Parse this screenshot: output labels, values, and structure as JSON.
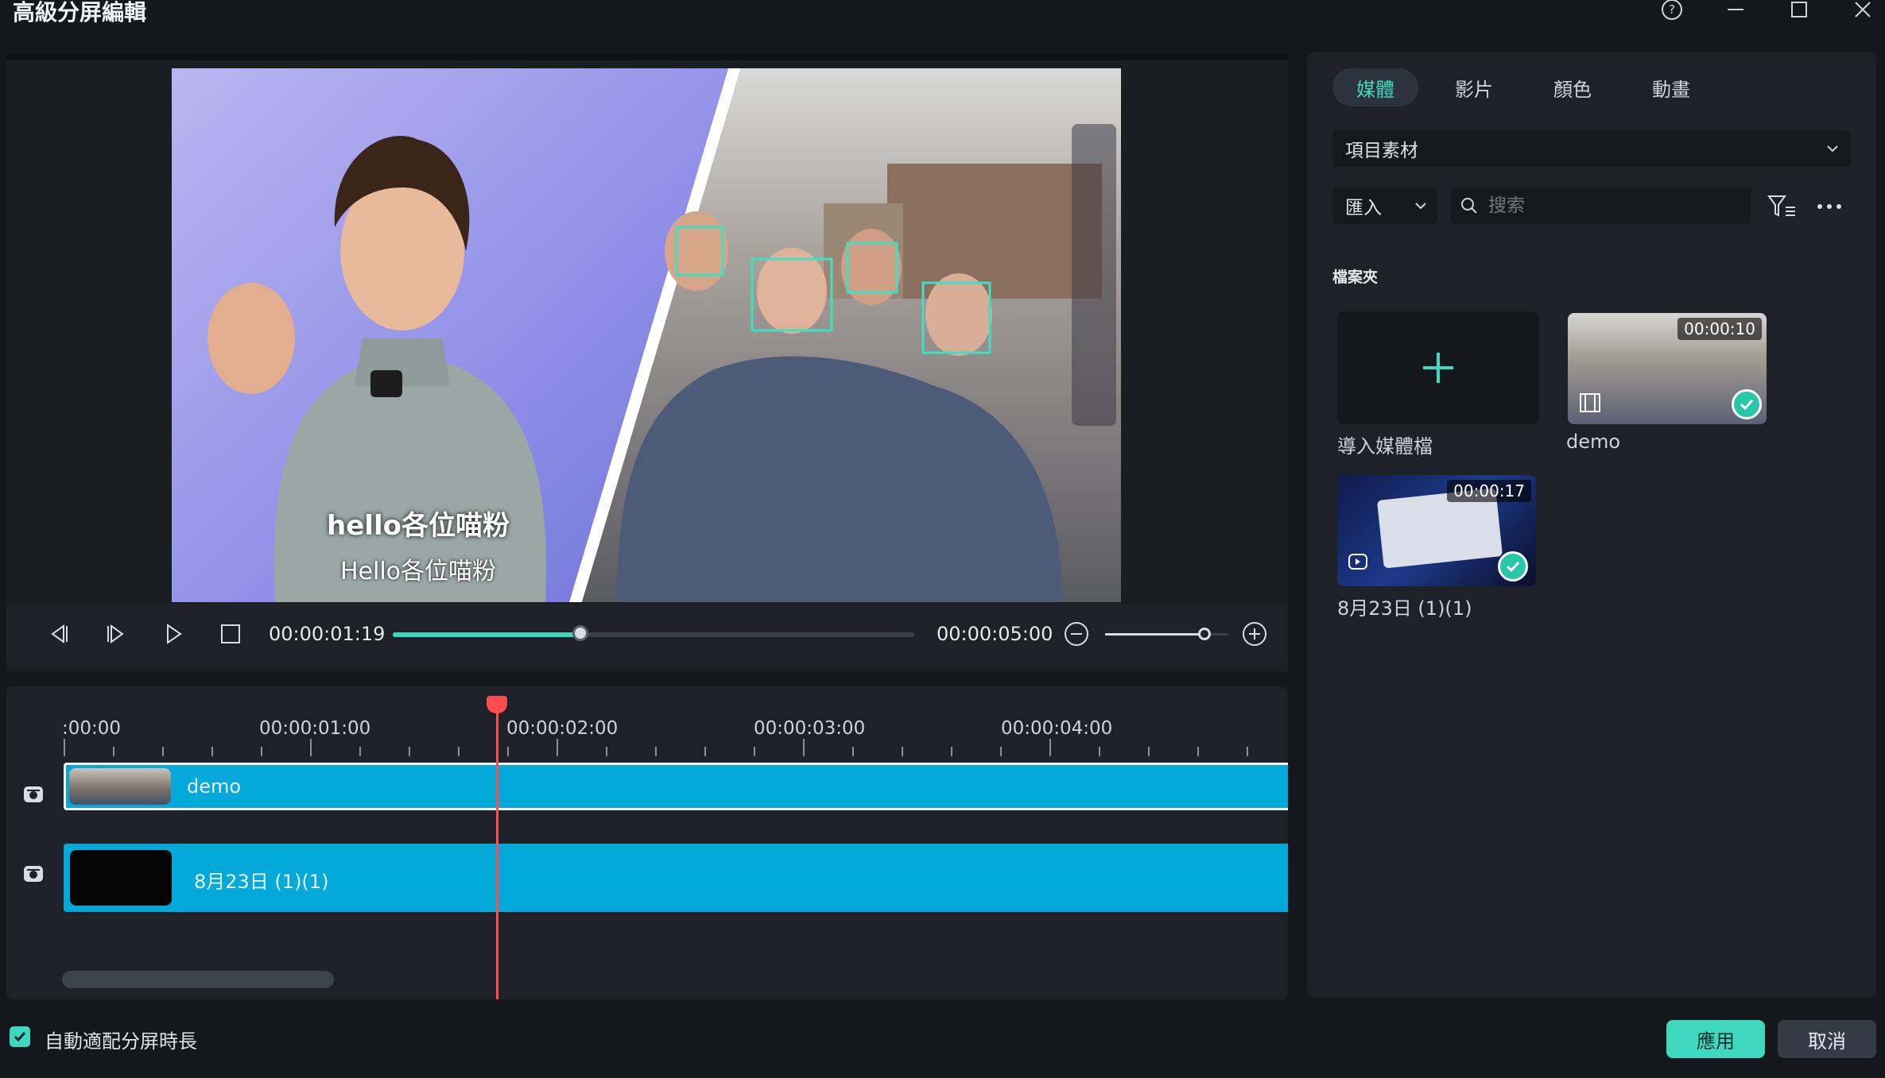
{
  "window": {
    "title": "高級分屏編輯",
    "controls": [
      "help-icon",
      "minimize-icon",
      "maximize-icon",
      "close-icon"
    ]
  },
  "preview": {
    "subtitle_main": "hello各位喵粉",
    "subtitle_secondary": "Hello各位喵粉",
    "current_time": "00:00:01:19",
    "total_time": "00:00:05:00",
    "progress_fraction": 0.36,
    "zoom_fraction": 0.81
  },
  "timeline": {
    "ruler_labels": [
      ":00:00",
      "00:00:01:00",
      "00:00:02:00",
      "00:00:03:00",
      "00:00:04:00"
    ],
    "playhead_time": "00:00:01:19",
    "tracks": [
      {
        "label": "demo"
      },
      {
        "label": "8月23日 (1)(1)"
      }
    ]
  },
  "media_panel": {
    "tabs": [
      "媒體",
      "影片",
      "顏色",
      "動畫"
    ],
    "active_tab": "媒體",
    "source_dropdown": "項目素材",
    "import_dropdown": "匯入",
    "search_placeholder": "搜索",
    "folder_label": "檔案夾",
    "import_tile_label": "導入媒體檔",
    "items": [
      {
        "name": "demo",
        "duration": "00:00:10",
        "added": true
      },
      {
        "name": "8月23日 (1)(1)",
        "duration": "00:00:17",
        "added": true
      }
    ]
  },
  "footer": {
    "auto_fit_label": "自動適配分屏時長",
    "auto_fit_checked": true,
    "apply_label": "應用",
    "cancel_label": "取消"
  },
  "colors": {
    "accent": "#3fd8be",
    "track": "#03a9d9",
    "playhead": "#ff4d4f",
    "apply_button": "#3fd8be"
  }
}
